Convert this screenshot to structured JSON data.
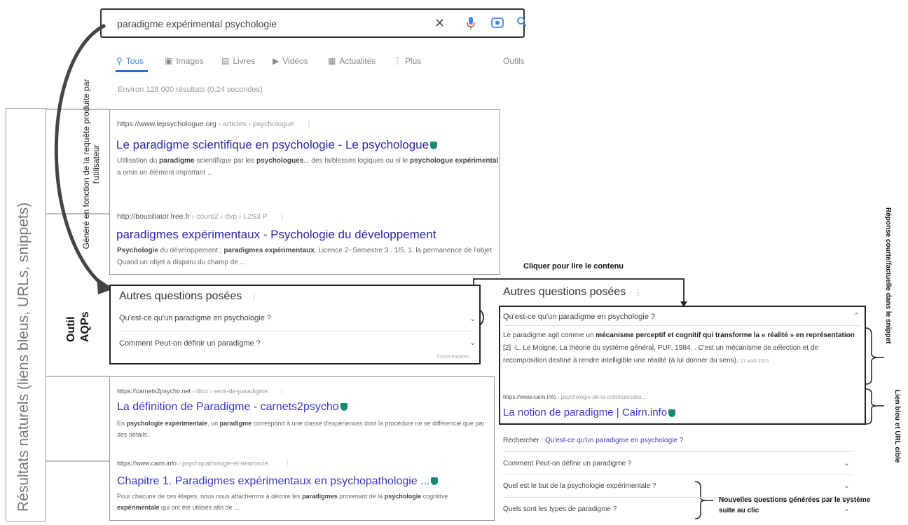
{
  "search": {
    "query": "paradigme expérimental psychologie"
  },
  "tabs": [
    {
      "label": "Tous"
    },
    {
      "label": "Images"
    },
    {
      "label": "Livres"
    },
    {
      "label": "Vidéos"
    },
    {
      "label": "Actualités"
    },
    {
      "label": "Plus"
    }
  ],
  "tools_label": "Outils",
  "stats": "Environ 128 000 résultats (0,24 secondes)",
  "labels": {
    "natural_results": "Résultats naturels (liens bleus, URLs, snippets)",
    "generated": "Généré en fonction de la requête produite par l'utilisateur",
    "tool_line1": "Outil",
    "tool_line2": "AQPs",
    "click_to_read": "Cliquer pour lire le contenu",
    "short_answer": "Réponse courte/factuelle dans le snippet",
    "blue_link": "Lien bleu et URL cible",
    "new_questions": "Nouvelles questions générées par le système suite au clic"
  },
  "results_top": [
    {
      "url": "https://www.lepsychologue.org",
      "crumb": " › articles › psychologue",
      "title": "Le paradigme scientifique en psychologie - Le psychologue",
      "snippet_parts": [
        "Utilisation du ",
        "paradigme",
        " scientifique par les ",
        "psychologues",
        "... des faiblesses logiques ou si le ",
        "psychologue expérimental",
        " a omis un élément important ..."
      ]
    },
    {
      "url": "http://bousillator.free.fr",
      "crumb": " › cours2 › dvp › L2S3 P",
      "title": "paradigmes expérimentaux - Psychologie du développement",
      "snippet_parts": [
        "Psychologie",
        " du développement ; ",
        "paradigmes expérimentaux",
        ". Licence 2- Semestre 3 . 1/5. 1. la permanence de l'objet. Quand un objet a disparu du champ de ..."
      ]
    }
  ],
  "paa_left": {
    "title": "Autres questions posées",
    "questions": [
      "Qu'est-ce qu'un paradigme en psychologie ?",
      "Comment Peut-on définir un paradigme ?"
    ],
    "feedback": "Commentaires"
  },
  "results_bottom": [
    {
      "url": "https://carnets2psycho.net",
      "crumb": " › dico › sens-de-paradigme",
      "title": "La définition de Paradigme - carnets2psycho",
      "snippet_parts": [
        "En ",
        "psychologie expérimentale",
        ", un ",
        "paradigme",
        " correspond à une classe d'expériences dont la procédure ne se différencie que par des détails."
      ]
    },
    {
      "url": "https://www.cairn.info",
      "crumb": " › psychopathologie-et-neuroscie...",
      "title": "Chapitre 1. Paradigmes expérimentaux en psychopathologie ...",
      "snippet_parts": [
        "Pour chacune de ces étapes, nous nous attacherons à décrire les ",
        "paradigmes",
        " provenant de la ",
        "psychologie",
        " cognitive ",
        "expérimentale",
        " qui ont été utilisés afin de ..."
      ]
    }
  ],
  "paa_right": {
    "title": "Autres questions posées",
    "open_question": "Qu'est-ce qu'un paradigme en psychologie ?",
    "answer_parts": [
      "Le paradigme agit comme un ",
      "mécanisme perceptif et cognitif qui transforme la « réalité » en représentation",
      " [2] -L. Le Moigne, La théorie du système général, PUF, 1984. . C'est un mécanisme de sélection et de recomposition destiné à rendre intelligible une réalité (à lui donner du sens). "
    ],
    "date": "21 août 2015",
    "result_url": "https://www.cairn.info",
    "result_crumb": " › psychologie-de-la-communicatio...",
    "result_title": "La notion de paradigme | Cairn.info",
    "search_prefix": "Rechercher : ",
    "search_link": "Qu'est-ce qu'un paradigme en psychologie ?",
    "more_questions": [
      "Comment Peut-on définir un paradigme ?",
      "Quel est le but de la psychologie expérimentale ?",
      "Quels sont les types de paradigme ?"
    ]
  }
}
